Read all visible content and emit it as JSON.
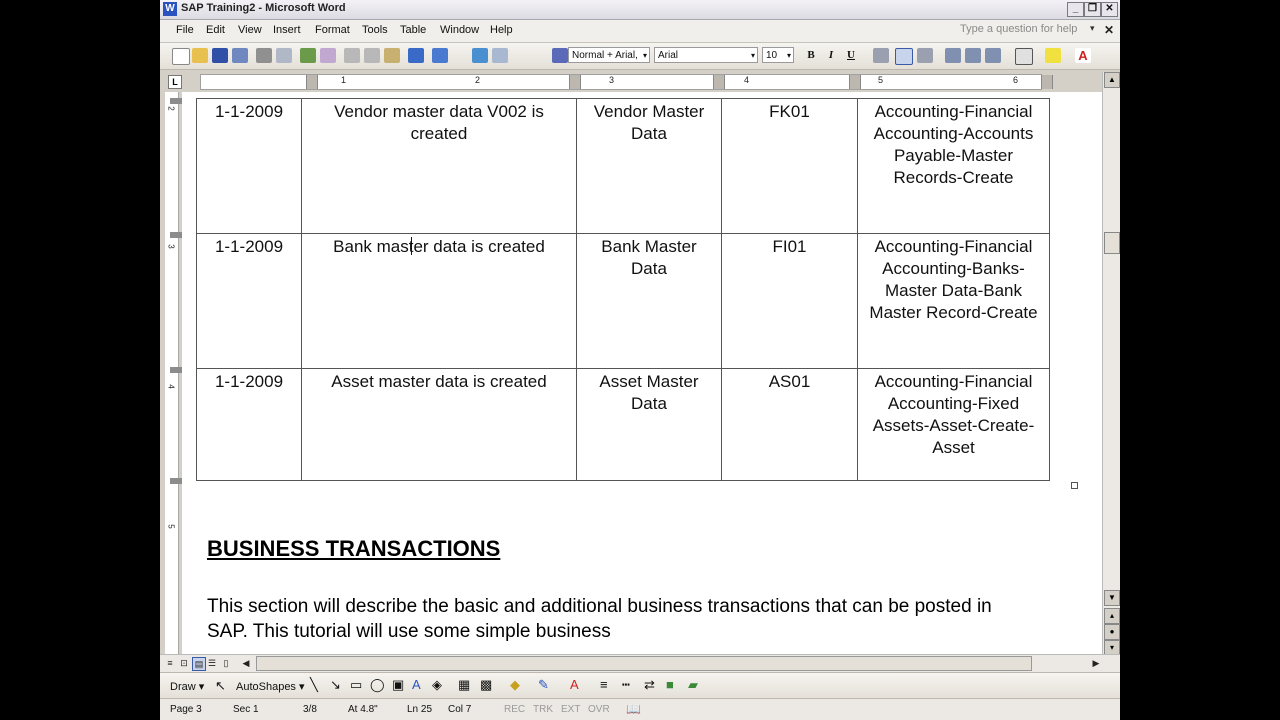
{
  "window": {
    "title": "SAP Training2 - Microsoft Word",
    "app_icon": "W"
  },
  "menu": [
    "File",
    "Edit",
    "View",
    "Insert",
    "Format",
    "Tools",
    "Table",
    "Window",
    "Help"
  ],
  "help_placeholder": "Type a question for help",
  "formatting": {
    "style": "Normal + Arial,",
    "font": "Arial",
    "size": "10"
  },
  "ruler": {
    "numbers": [
      "1",
      "2",
      "3",
      "4",
      "5",
      "6"
    ],
    "vnumbers": [
      "2",
      "3",
      "4",
      "5"
    ]
  },
  "table": {
    "rows": [
      [
        "1-1-2009",
        "Vendor master data V002 is created",
        "Vendor Master Data",
        "FK01",
        "Accounting-Financial Accounting-Accounts Payable-Master Records-Create"
      ],
      [
        "1-1-2009",
        "Bank master data is created",
        "Bank Master Data",
        "FI01",
        "Accounting-Financial Accounting-Banks-Master Data-Bank Master Record-Create"
      ],
      [
        "1-1-2009",
        "Asset master data is created",
        "Asset Master Data",
        "AS01",
        "Accounting-Financial Accounting-Fixed Assets-Asset-Create-Asset"
      ]
    ]
  },
  "heading": "BUSINESS TRANSACTIONS",
  "paragraph": "This section will describe the basic and additional business transactions that can be posted in SAP. This tutorial will use some simple business",
  "drawbar": {
    "draw": "Draw ▾",
    "autoshapes": "AutoShapes ▾"
  },
  "status": {
    "page": "Page 3",
    "sec": "Sec 1",
    "pages": "3/8",
    "at": "At 4.8\"",
    "ln": "Ln 25",
    "col": "Col 7",
    "rec": "REC",
    "trk": "TRK",
    "ext": "EXT",
    "ovr": "OVR"
  }
}
